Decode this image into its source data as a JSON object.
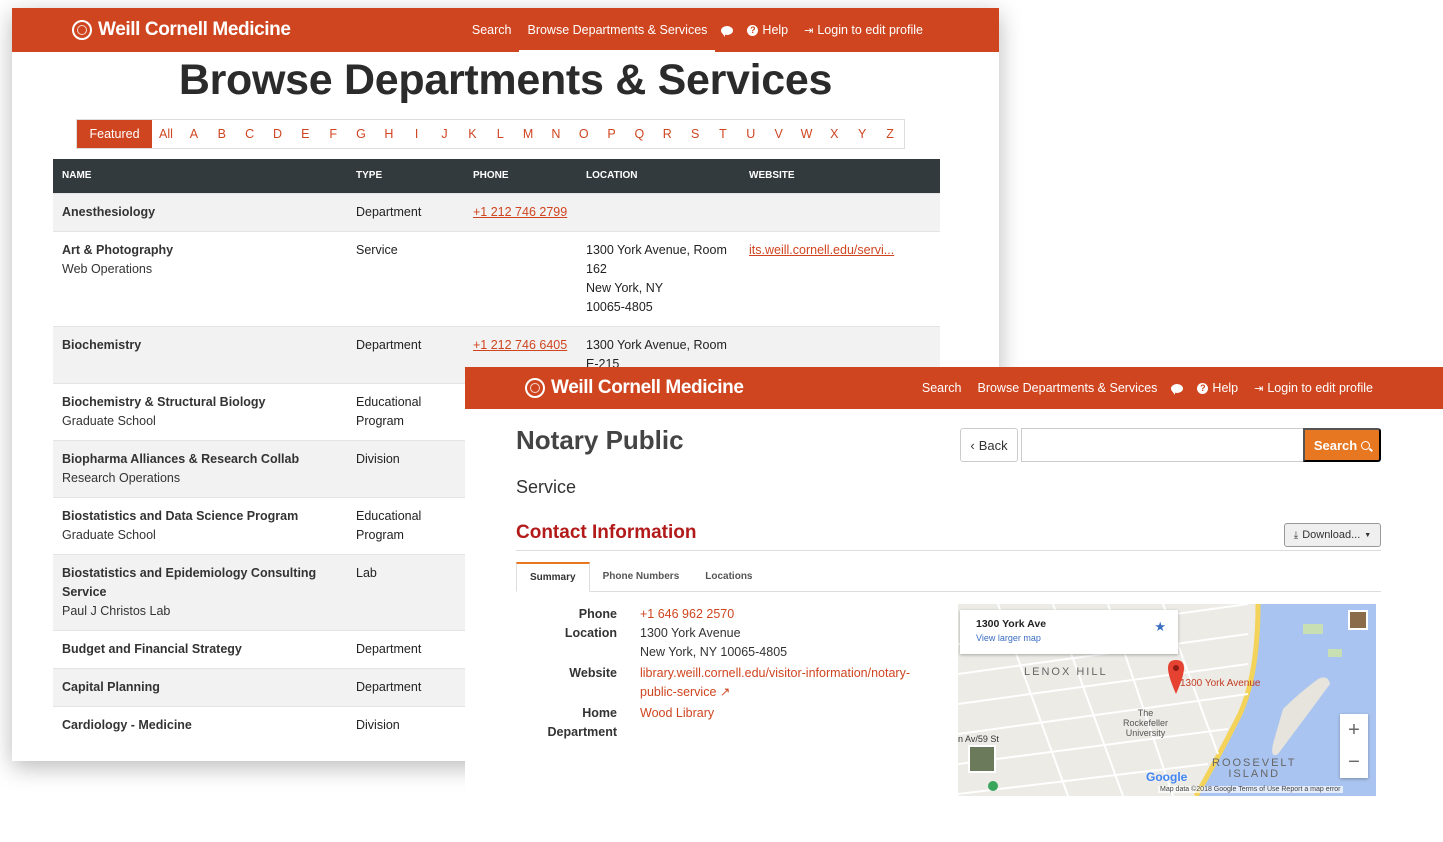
{
  "brand": "Weill Cornell Medicine",
  "nav": {
    "search": "Search",
    "browse": "Browse Departments & Services",
    "help": "Help",
    "login": "Login to edit profile"
  },
  "browse_page": {
    "title": "Browse Departments & Services",
    "alphabet": {
      "featured": "Featured",
      "all": "All",
      "letters": [
        "A",
        "B",
        "C",
        "D",
        "E",
        "F",
        "G",
        "H",
        "I",
        "J",
        "K",
        "L",
        "M",
        "N",
        "O",
        "P",
        "Q",
        "R",
        "S",
        "T",
        "U",
        "V",
        "W",
        "X",
        "Y",
        "Z"
      ]
    },
    "columns": [
      "NAME",
      "TYPE",
      "PHONE",
      "LOCATION",
      "WEBSITE"
    ],
    "rows": [
      {
        "name": "Anesthesiology",
        "sub": "",
        "type": "Department",
        "phone": "+1 212 746 2799",
        "loc": [
          "",
          "",
          "",
          ""
        ],
        "web": ""
      },
      {
        "name": "Art & Photography",
        "sub": "Web Operations",
        "type": "Service",
        "phone": "",
        "loc": [
          "1300 York Avenue, Room",
          "162",
          "New York, NY",
          "10065-4805"
        ],
        "web": "its.weill.cornell.edu/servi..."
      },
      {
        "name": "Biochemistry",
        "sub": "",
        "type": "Department",
        "phone": "+1 212 746 6405",
        "loc": [
          "1300 York Avenue, Room",
          "E-215",
          "",
          ""
        ],
        "web": ""
      },
      {
        "name": "Biochemistry & Structural Biology",
        "sub": "Graduate School",
        "type": "Educational Program",
        "phone": "",
        "loc": [
          "",
          "",
          "",
          ""
        ],
        "web": ""
      },
      {
        "name": "Biopharma Alliances & Research Collab",
        "sub": "Research Operations",
        "type": "Division",
        "phone": "",
        "loc": [
          "",
          "",
          "",
          ""
        ],
        "web": ""
      },
      {
        "name": "Biostatistics and Data Science Program",
        "sub": "Graduate School",
        "type": "Educational Program",
        "phone": "",
        "loc": [
          "",
          "",
          "",
          ""
        ],
        "web": ""
      },
      {
        "name": "Biostatistics and Epidemiology Consulting Service",
        "sub": "Paul J Christos Lab",
        "type": "Lab",
        "phone": "",
        "loc": [
          "",
          "",
          "",
          ""
        ],
        "web": ""
      },
      {
        "name": "Budget and Financial Strategy",
        "sub": "",
        "type": "Department",
        "phone": "",
        "loc": [
          "",
          "",
          "",
          ""
        ],
        "web": ""
      },
      {
        "name": "Capital Planning",
        "sub": "",
        "type": "Department",
        "phone": "",
        "loc": [
          "",
          "",
          "",
          ""
        ],
        "web": ""
      },
      {
        "name": "Cardiology - Medicine",
        "sub": "",
        "type": "Division",
        "phone": "",
        "loc": [
          "",
          "",
          "",
          ""
        ],
        "web": ""
      }
    ]
  },
  "detail_page": {
    "title": "Notary Public",
    "back": "Back",
    "search_button": "Search",
    "search_placeholder": "",
    "type": "Service",
    "contact_heading": "Contact Information",
    "download": "Download...",
    "tabs": [
      "Summary",
      "Phone Numbers",
      "Locations"
    ],
    "info": {
      "phone_label": "Phone",
      "phone": "+1 646 962 2570",
      "location_label": "Location",
      "location_line1": "1300 York Avenue",
      "location_line2": "New York, NY 10065-4805",
      "website_label": "Website",
      "website_line1": "library.weill.cornell.edu/visitor-information/notary-",
      "website_line2": "public-service",
      "home_dept_label": "Home Department",
      "home_dept": "Wood Library"
    },
    "map": {
      "card_address": "1300 York Ave",
      "card_link": "View larger map",
      "pin_label": "1300 York Avenue",
      "area_lenox": "LENOX HILL",
      "rockefeller": [
        "The",
        "Rockefeller",
        "University"
      ],
      "roosevelt": [
        "ROOSEVELT",
        "ISLAND"
      ],
      "street_label": "n Av/59 St",
      "google": "Google",
      "attribution": "Map data ©2018 Google   Terms of Use   Report a map error",
      "zoom_in": "+",
      "zoom_out": "−"
    }
  },
  "colors": {
    "brand_red": "#cf4520",
    "accent_orange": "#e87722",
    "heading_red": "#b31b1b",
    "table_header": "#333a3e"
  }
}
